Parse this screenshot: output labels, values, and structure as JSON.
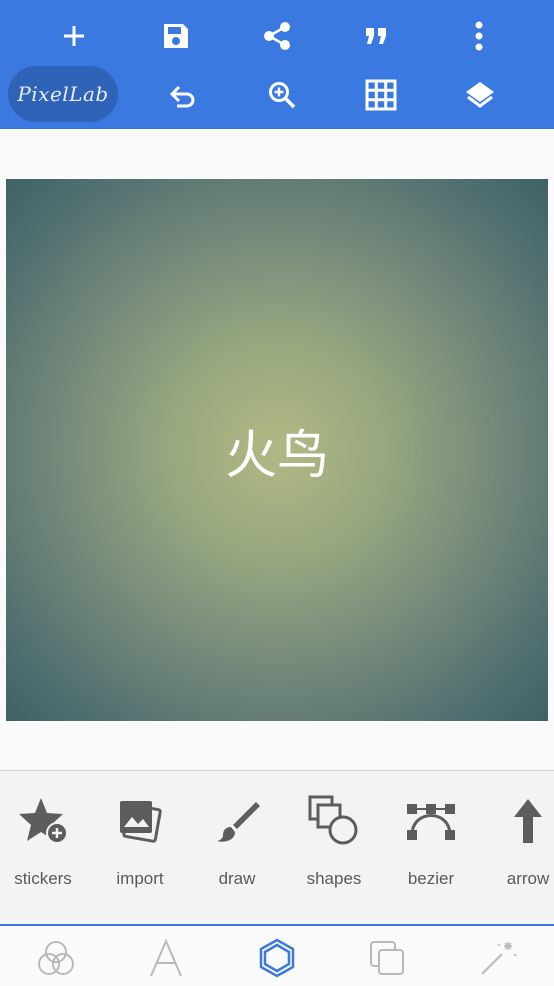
{
  "app": {
    "logo_text": "PixelLab"
  },
  "toolbar": {
    "row1": [
      "add-icon",
      "save-icon",
      "share-icon",
      "quote-icon",
      "more-vertical-icon"
    ],
    "row2": [
      "undo-icon",
      "zoom-in-icon",
      "grid-icon",
      "layers-icon"
    ]
  },
  "canvas": {
    "text": "火鸟"
  },
  "tools": {
    "items": [
      {
        "label": "stickers",
        "icon": "sticker-add-icon"
      },
      {
        "label": "import",
        "icon": "image-import-icon"
      },
      {
        "label": "draw",
        "icon": "brush-icon"
      },
      {
        "label": "shapes",
        "icon": "shapes-icon"
      },
      {
        "label": "bezier",
        "icon": "bezier-icon"
      },
      {
        "label": "arrow",
        "icon": "arrow-up-icon"
      }
    ]
  },
  "bottom_nav": {
    "tabs": [
      "effects-icon",
      "text-icon",
      "add-shape-icon",
      "layer-copy-icon",
      "magic-icon"
    ],
    "active": "add-shape-icon"
  },
  "colors": {
    "accent": "#3a7ae0",
    "logo_bg": "#2f63b8",
    "tool_icon": "#5d5d5d",
    "nav_icon": "#b9b9b9"
  }
}
